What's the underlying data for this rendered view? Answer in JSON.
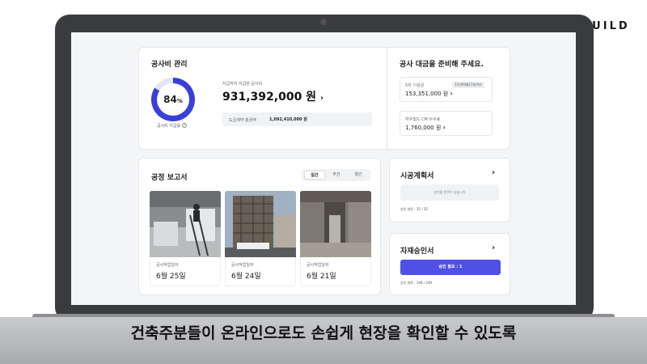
{
  "brand": "HOWBUILD",
  "subtitle": "건축주분들이 온라인으로도 손쉽게 현장을 확인할 수 있도록",
  "cost": {
    "title": "공사비 관리",
    "percent": "84",
    "percent_unit": "%",
    "percent_value": 84,
    "ratio_label": "공사비 지급률",
    "paid_label": "지급까지 지급한 공사비",
    "paid_amount": "931,392,000 원",
    "contract_label": "도급계약 총금액",
    "contract_amount": "1,092,410,000 원"
  },
  "payment": {
    "title": "공사 대금을 준비해 주세요.",
    "items": [
      {
        "label": "5차 기성금",
        "amount": "153,351,000 원",
        "chip": "23년08월12일까지"
      },
      {
        "label": "하우빌드 CM 수수료",
        "amount": "1,760,000 원",
        "chip": ""
      }
    ]
  },
  "report": {
    "title": "공정 보고서",
    "tabs": [
      "일간",
      "주간",
      "월간"
    ],
    "photos": [
      {
        "label": "공사작업일자",
        "date": "6월 25일"
      },
      {
        "label": "공사작업일자",
        "date": "6월 24일"
      },
      {
        "label": "공사작업일자",
        "date": "6월 21일"
      }
    ]
  },
  "plan": {
    "title": "시공계획서",
    "empty": "승인할 항목이 없습니다",
    "status": "승인 완료 : 35 / 35"
  },
  "material": {
    "title": "자재승인서",
    "button": "승인 필요 : 1",
    "status": "승인 완료 : 198 / 249"
  },
  "colors": {
    "accent": "#3b3fd9",
    "button": "#4f51e6"
  }
}
